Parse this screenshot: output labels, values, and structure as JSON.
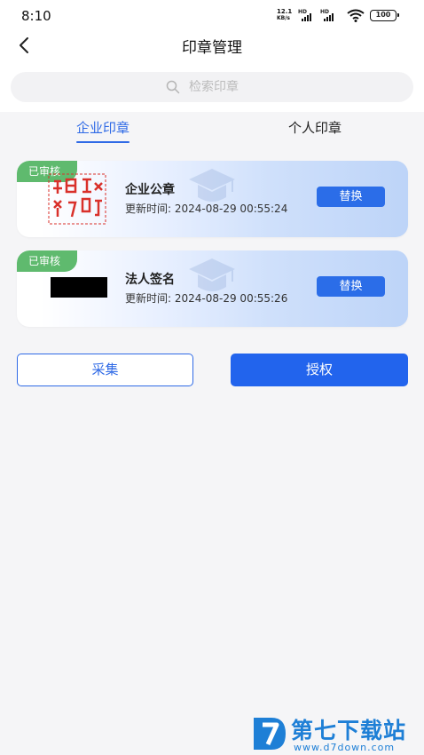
{
  "status_bar": {
    "time": "8:10",
    "net_speed_value": "12.1",
    "net_speed_unit": "KB/s",
    "signal_label": "HD",
    "battery": "100"
  },
  "header": {
    "title": "印章管理",
    "search_placeholder": "检索印章"
  },
  "tabs": [
    {
      "label": "企业印章",
      "active": true
    },
    {
      "label": "个人印章",
      "active": false
    }
  ],
  "seals": [
    {
      "status": "已审核",
      "name": "企业公章",
      "update_label": "更新时间:",
      "update_time": "2024-08-29 00:55:24",
      "action": "替换",
      "image": "company-seal"
    },
    {
      "status": "已审核",
      "name": "法人签名",
      "update_label": "更新时间:",
      "update_time": "2024-08-29 00:55:26",
      "action": "替换",
      "image": "signature-redacted"
    }
  ],
  "actions": {
    "collect": "采集",
    "authorize": "授权"
  },
  "watermark": {
    "name": "第七下载站",
    "url": "www.d7down.com"
  },
  "colors": {
    "accent": "#2f6ae6",
    "button": "#2264ed",
    "badge": "#5fba6e",
    "seal_red": "#d9302a",
    "logo": "#1e7fd6"
  },
  "icons": {
    "back": "chevron-left-icon",
    "search": "search-icon",
    "wifi": "wifi-icon",
    "battery": "battery-icon"
  }
}
